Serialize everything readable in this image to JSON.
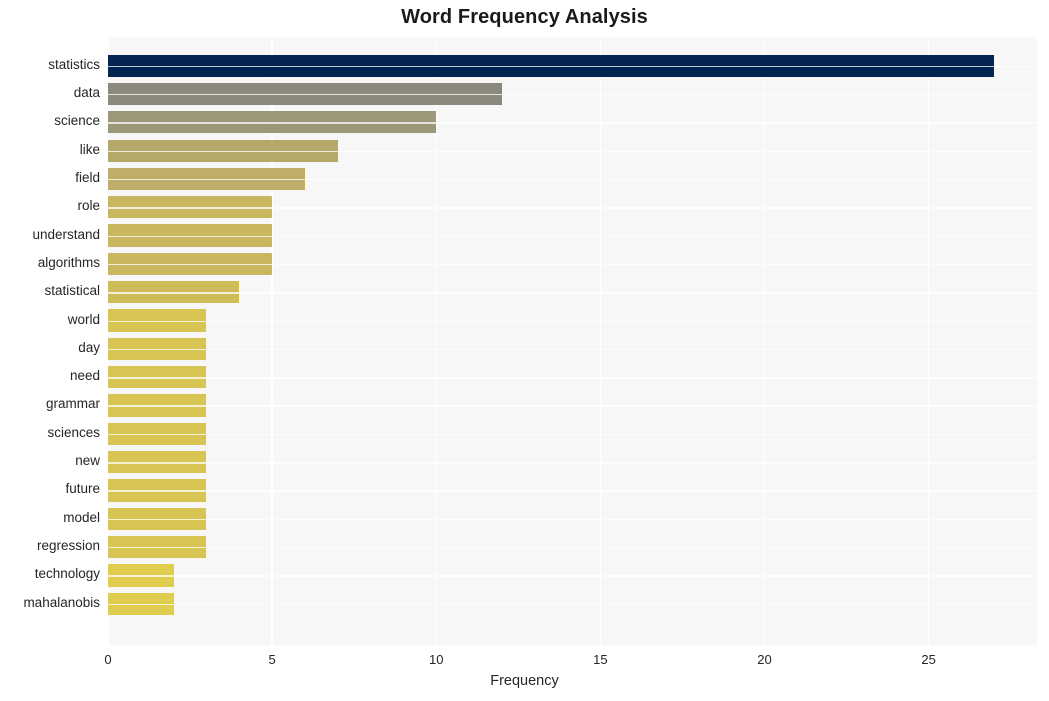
{
  "chart_data": {
    "type": "bar",
    "orientation": "horizontal",
    "title": "Word Frequency Analysis",
    "xlabel": "Frequency",
    "ylabel": "",
    "xlim": [
      0,
      28.3
    ],
    "xticks": [
      0,
      5,
      10,
      15,
      20,
      25
    ],
    "xticklabels": [
      "0",
      "5",
      "10",
      "15",
      "20",
      "25"
    ],
    "grid": true,
    "grid_axis": "x",
    "legend": false,
    "categories": [
      "statistics",
      "data",
      "science",
      "like",
      "field",
      "role",
      "understand",
      "algorithms",
      "statistical",
      "world",
      "day",
      "need",
      "grammar",
      "sciences",
      "new",
      "future",
      "model",
      "regression",
      "technology",
      "mahalanobis"
    ],
    "values": [
      27,
      12,
      10,
      7,
      6,
      5,
      5,
      5,
      4,
      3,
      3,
      3,
      3,
      3,
      3,
      3,
      3,
      3,
      2,
      2
    ],
    "bar_colors": [
      "#042551",
      "#8b897e",
      "#9d9779",
      "#b5a86b",
      "#bfae68",
      "#c9b65f",
      "#c9b65f",
      "#c9b65f",
      "#cfbc58",
      "#d8c452",
      "#d8c452",
      "#d8c452",
      "#d8c452",
      "#d8c452",
      "#d8c452",
      "#d8c452",
      "#d8c452",
      "#d8c452",
      "#e0cd4f",
      "#e0cd4f"
    ]
  },
  "style": {
    "plot_background": "#f7f7f7",
    "figure_background": "#ffffff",
    "grid_color": "#ffffff",
    "text_color": "#262626",
    "title_color": "#1a1a1a"
  }
}
